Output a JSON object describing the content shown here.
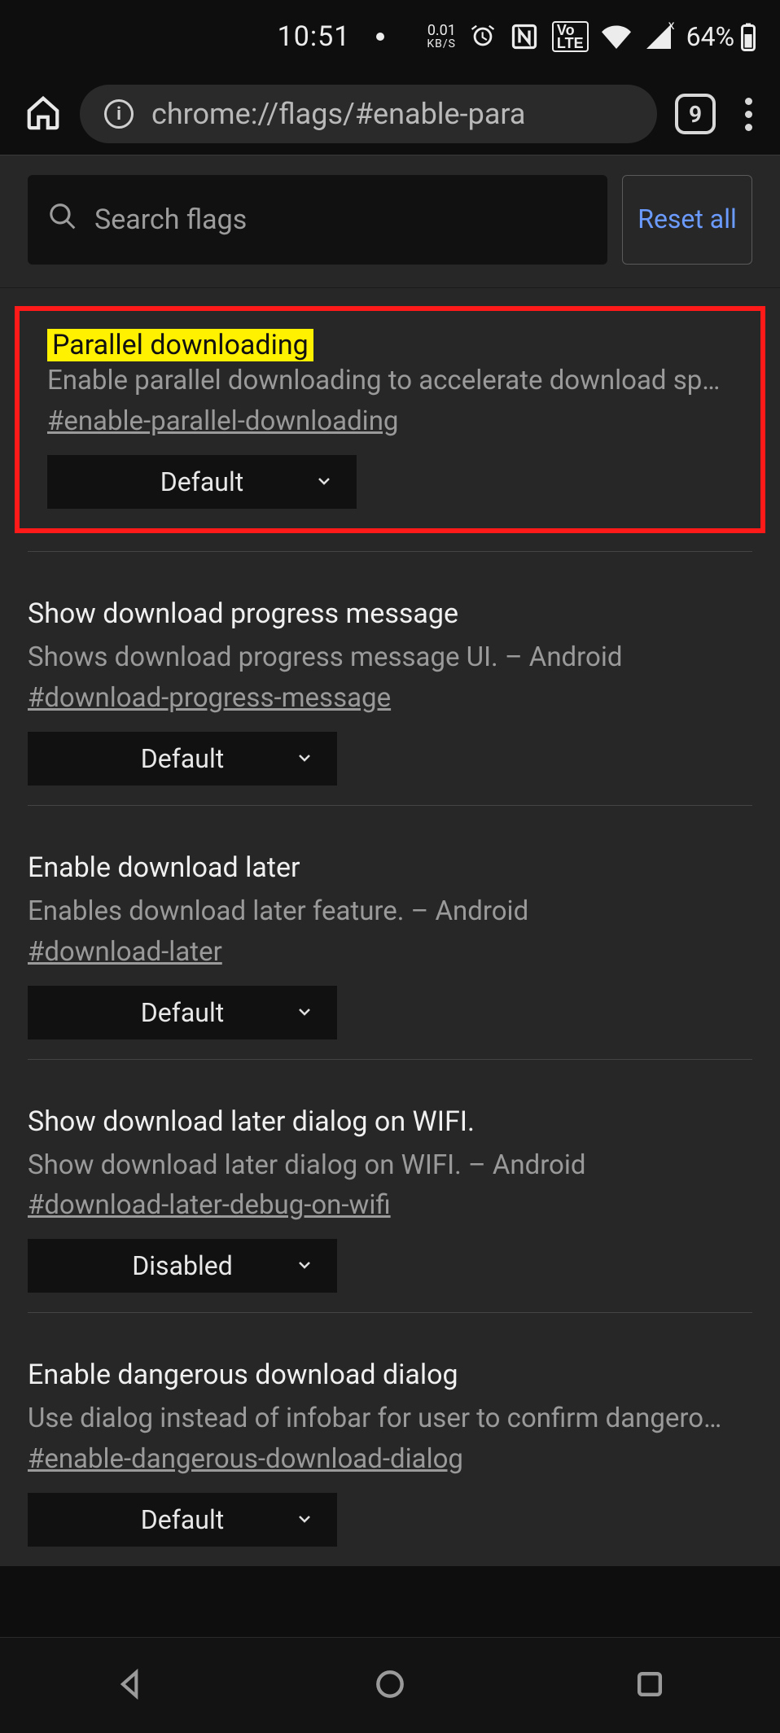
{
  "status": {
    "time": "10:51",
    "speed_value": "0.01",
    "speed_unit": "KB/S",
    "volte": "Vo\nLTE",
    "battery": "64%"
  },
  "browser": {
    "url": "chrome://flags/#enable-para",
    "tab_count": "9"
  },
  "search": {
    "placeholder": "Search flags",
    "reset_label": "Reset all"
  },
  "flags": [
    {
      "title": "Parallel downloading",
      "desc": "Enable parallel downloading to accelerate download spe…",
      "hash": "#enable-parallel-downloading",
      "value": "Default",
      "highlighted": true
    },
    {
      "title": "Show download progress message",
      "desc": "Shows download progress message UI. – Android",
      "hash": "#download-progress-message",
      "value": "Default"
    },
    {
      "title": "Enable download later",
      "desc": "Enables download later feature. – Android",
      "hash": "#download-later",
      "value": "Default"
    },
    {
      "title": "Show download later dialog on WIFI.",
      "desc": "Show download later dialog on WIFI. – Android",
      "hash": "#download-later-debug-on-wifi",
      "value": "Disabled"
    },
    {
      "title": "Enable dangerous download dialog",
      "desc": "Use dialog instead of infobar for user to confirm dangero…",
      "hash": "#enable-dangerous-download-dialog",
      "value": "Default"
    }
  ]
}
